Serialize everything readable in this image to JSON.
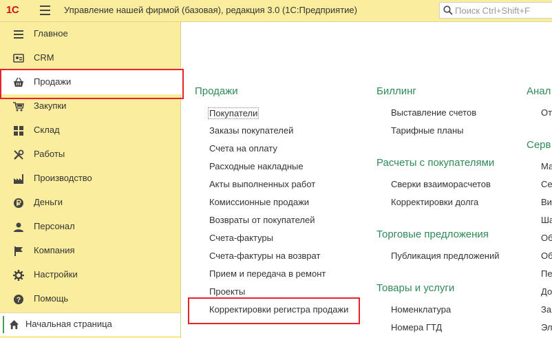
{
  "header": {
    "logo": "1С",
    "title": "Управление нашей фирмой (базовая), редакция 3.0  (1С:Предприятие)",
    "search_placeholder": "Поиск Ctrl+Shift+F"
  },
  "sidebar": {
    "items": [
      {
        "label": "Главное",
        "icon": "list-icon"
      },
      {
        "label": "CRM",
        "icon": "crm-icon"
      },
      {
        "label": "Продажи",
        "icon": "basket-icon",
        "active": true
      },
      {
        "label": "Закупки",
        "icon": "cart-icon"
      },
      {
        "label": "Склад",
        "icon": "warehouse-icon"
      },
      {
        "label": "Работы",
        "icon": "tools-icon"
      },
      {
        "label": "Производство",
        "icon": "factory-icon"
      },
      {
        "label": "Деньги",
        "icon": "coin-icon"
      },
      {
        "label": "Персонал",
        "icon": "person-icon"
      },
      {
        "label": "Компания",
        "icon": "flag-icon"
      },
      {
        "label": "Настройки",
        "icon": "gear-icon"
      },
      {
        "label": "Помощь",
        "icon": "help-icon"
      }
    ],
    "home": "Начальная страница"
  },
  "sections": {
    "sales": {
      "title": "Продажи",
      "links": [
        "Покупатели",
        "Заказы покупателей",
        "Счета на оплату",
        "Расходные накладные",
        "Акты выполненных работ",
        "Комиссионные продажи",
        "Возвраты от покупателей",
        "Счета-фактуры",
        "Счета-фактуры на возврат",
        "Прием и передача в ремонт",
        "Проекты",
        "Корректировки регистра продажи"
      ]
    },
    "billing": {
      "title": "Биллинг",
      "links": [
        "Выставление счетов",
        "Тарифные планы"
      ]
    },
    "settlements": {
      "title": "Расчеты с покупателями",
      "links": [
        "Сверки взаиморасчетов",
        "Корректировки долга"
      ]
    },
    "offers": {
      "title": "Торговые предложения",
      "links": [
        "Публикация предложений"
      ]
    },
    "goods": {
      "title": "Товары и услуги",
      "links": [
        "Номенклатура",
        "Номера ГТД"
      ]
    },
    "analysis": {
      "title": "Анал",
      "links": [
        "От"
      ]
    },
    "service": {
      "title": "Серв",
      "links": [
        "Ма",
        "Се",
        "Ви",
        "Ша",
        "Об",
        "Об",
        "Пе",
        "До",
        "За",
        "Эл"
      ]
    }
  },
  "colors": {
    "header_bg": "#fbed9e",
    "section_title": "#2e8a57",
    "highlight": "#e8232a",
    "logo": "#d0121a"
  }
}
